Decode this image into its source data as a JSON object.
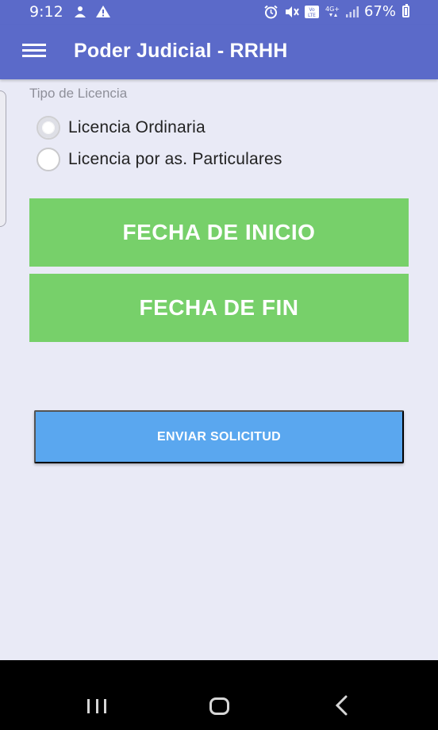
{
  "status_bar": {
    "time": "9:12",
    "left_icons": [
      "person-notification-icon",
      "warning-icon"
    ],
    "right_icons": [
      "alarm-icon",
      "mute-icon",
      "volte-icon",
      "4g-icon",
      "signal-icon"
    ],
    "battery": "67%"
  },
  "app_bar": {
    "title": "Poder Judicial - RRHH",
    "menu_icon": "hamburger-menu-icon"
  },
  "form": {
    "section_label": "Tipo de Licencia",
    "radio_options": [
      {
        "label": "Licencia Ordinaria",
        "checked": true
      },
      {
        "label": "Licencia por as. Particulares",
        "checked": false
      }
    ],
    "start_date_button": "FECHA DE INICIO",
    "end_date_button": "FECHA DE FIN",
    "submit_button": "ENVIAR SOLICITUD"
  },
  "colors": {
    "primary": "#5b6ac9",
    "background": "#e9eaf6",
    "green_button": "#77d06a",
    "blue_button": "#5aa7ef"
  },
  "nav_bar": {
    "icons": [
      "recent-apps-icon",
      "home-icon",
      "back-icon"
    ]
  }
}
